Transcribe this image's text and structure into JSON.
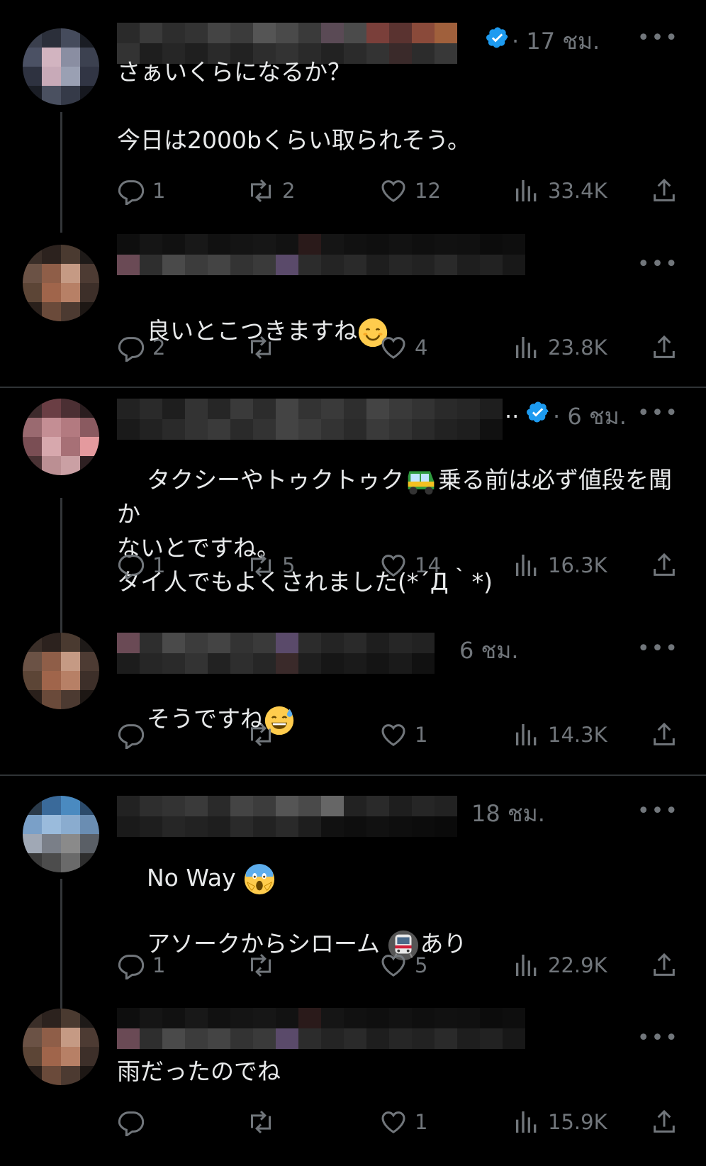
{
  "threads": [
    {
      "posts": [
        {
          "time": "· 17 ชม.",
          "verified": true,
          "text": "さぁいくらになるか？\n\n今日は2000bくらい取られそう。",
          "replies": "1",
          "reposts": "2",
          "likes": "12",
          "views": "33.4K"
        },
        {
          "time": "",
          "verified": false,
          "text": "良いとこつきますね",
          "emoji": "smiling-face",
          "replies": "2",
          "reposts": "",
          "likes": "4",
          "views": "23.8K"
        }
      ]
    },
    {
      "posts": [
        {
          "time": "· 6 ชม.",
          "verified": true,
          "prefix": "..",
          "text_a": "タクシーやトゥクトゥク",
          "text_b": "乗る前は必ず値段を聞か\nないとですね。\nタイ人でもよくされました(*´Д｀*)",
          "emoji": "auto-rickshaw",
          "replies": "1",
          "reposts": "5",
          "likes": "14",
          "views": "16.3K"
        },
        {
          "time": "6 ชม.",
          "verified": false,
          "text": "そうですね",
          "emoji": "sweat-smile",
          "replies": "",
          "reposts": "",
          "likes": "1",
          "views": "14.3K"
        }
      ]
    },
    {
      "posts": [
        {
          "time": "18 ชม.",
          "verified": false,
          "text": "No Way",
          "text_2": "アソークからシローム",
          "text_3": "あり",
          "emoji": "screaming-face",
          "emoji_2": "train",
          "replies": "1",
          "reposts": "",
          "likes": "5",
          "views": "22.9K"
        },
        {
          "time": "",
          "verified": false,
          "text": "雨だったのでね",
          "replies": "",
          "reposts": "",
          "likes": "1",
          "views": "15.9K"
        }
      ]
    }
  ],
  "more_label": "•••",
  "colors": {
    "bg": "#000000",
    "text": "#e7e9ea",
    "muted": "#71767b",
    "verified": "#1d9bf0",
    "divider": "#2f3336"
  }
}
